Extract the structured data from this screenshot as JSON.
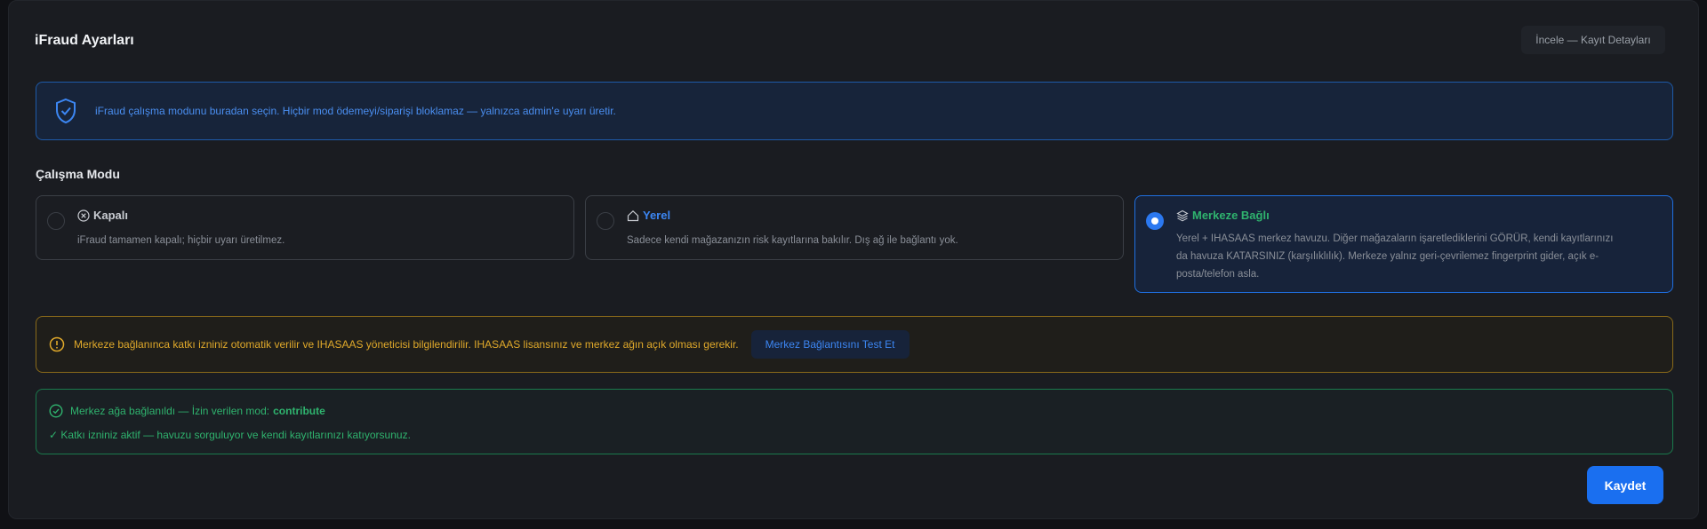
{
  "header": {
    "title": "iFraud Ayarları",
    "review_button": "İncele — Kayıt Detayları"
  },
  "info": {
    "icon": "shield-check-icon",
    "text": "iFraud çalışma modunu buradan seçin. Hiçbir mod ödemeyi/siparişi bloklamaz — yalnızca admin'e uyarı üretir."
  },
  "mode_section": {
    "title": "Çalışma Modu",
    "options": [
      {
        "icon": "x-circle-icon",
        "label": "Kapalı",
        "description": "iFraud tamamen kapalı; hiçbir uyarı üretilmez.",
        "selected": false,
        "color": "#c9ccd2"
      },
      {
        "icon": "home-icon",
        "label": "Yerel",
        "description": "Sadece kendi mağazanızın risk kayıtlarına bakılır. Dış ağ ile bağlantı yok.",
        "selected": false,
        "color": "#3c86f2"
      },
      {
        "icon": "layers-icon",
        "label": "Merkeze Bağlı",
        "description_lines": [
          "Yerel + IHASAAS merkez havuzu. Diğer mağazaların işaretlediklerini GÖRÜR, kendi kayıtlarınızı",
          "da havuza KATARSINIZ (karşılıklılık). Merkeze yalnız geri-çevrilemez fingerprint gider, açık e-",
          "posta/telefon asla."
        ],
        "selected": true,
        "color": "#2fb36e"
      }
    ]
  },
  "warning": {
    "icon": "alert-circle-icon",
    "text": "Merkeze bağlanınca katkı izniniz otomatik verilir ve IHASAAS yöneticisi bilgilendirilir. IHASAAS lisansınız ve merkez ağın açık olması gerekir.",
    "test_button": "Merkez Bağlantısını Test Et"
  },
  "status": {
    "icon": "check-circle-icon",
    "connected_text": "Merkez ağa bağlanıldı — İzin verilen mod:",
    "mode": "contribute",
    "detail": "✓ Katkı izniniz aktif — havuzu sorguluyor ve kendi kayıtlarınızı katıyorsunuz."
  },
  "actions": {
    "save_label": "Kaydet"
  },
  "colors": {
    "accent": "#1a6ff0",
    "success": "#2fb36e",
    "warning": "#e0a92a"
  }
}
